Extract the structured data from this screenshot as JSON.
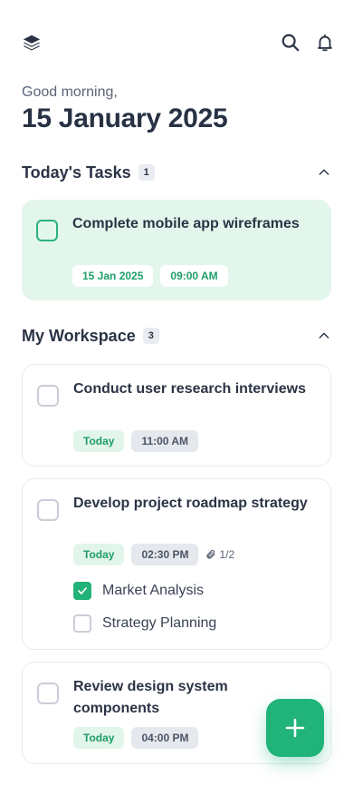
{
  "header": {
    "logo_icon": "layers-icon",
    "search_icon": "search-icon",
    "notifications_icon": "bell-icon"
  },
  "greeting": "Good morning,",
  "date_title": "15 January 2025",
  "today_section": {
    "title": "Today's Tasks",
    "count": "1",
    "collapse_icon": "chevron-up-icon",
    "tasks": [
      {
        "title": "Complete mobile app wireframes",
        "date": "15 Jan 2025",
        "time": "09:00 AM",
        "checked": false
      }
    ]
  },
  "workspace_section": {
    "title": "My Workspace",
    "count": "3",
    "collapse_icon": "chevron-up-icon",
    "tasks": [
      {
        "title": "Conduct user research interviews",
        "day": "Today",
        "time": "11:00 AM"
      },
      {
        "title": "Develop project roadmap strategy",
        "day": "Today",
        "time": "02:30 PM",
        "attachments": "1/2",
        "subtasks": [
          {
            "label": "Market Analysis",
            "checked": true
          },
          {
            "label": "Strategy Planning",
            "checked": false
          }
        ]
      },
      {
        "title": "Review design system components",
        "day": "Today",
        "time": "04:00 PM"
      }
    ]
  },
  "fab": {
    "icon": "plus-icon"
  },
  "colors": {
    "accent": "#20b37a",
    "accent_light": "#e3f6ec",
    "text": "#2b3445"
  }
}
